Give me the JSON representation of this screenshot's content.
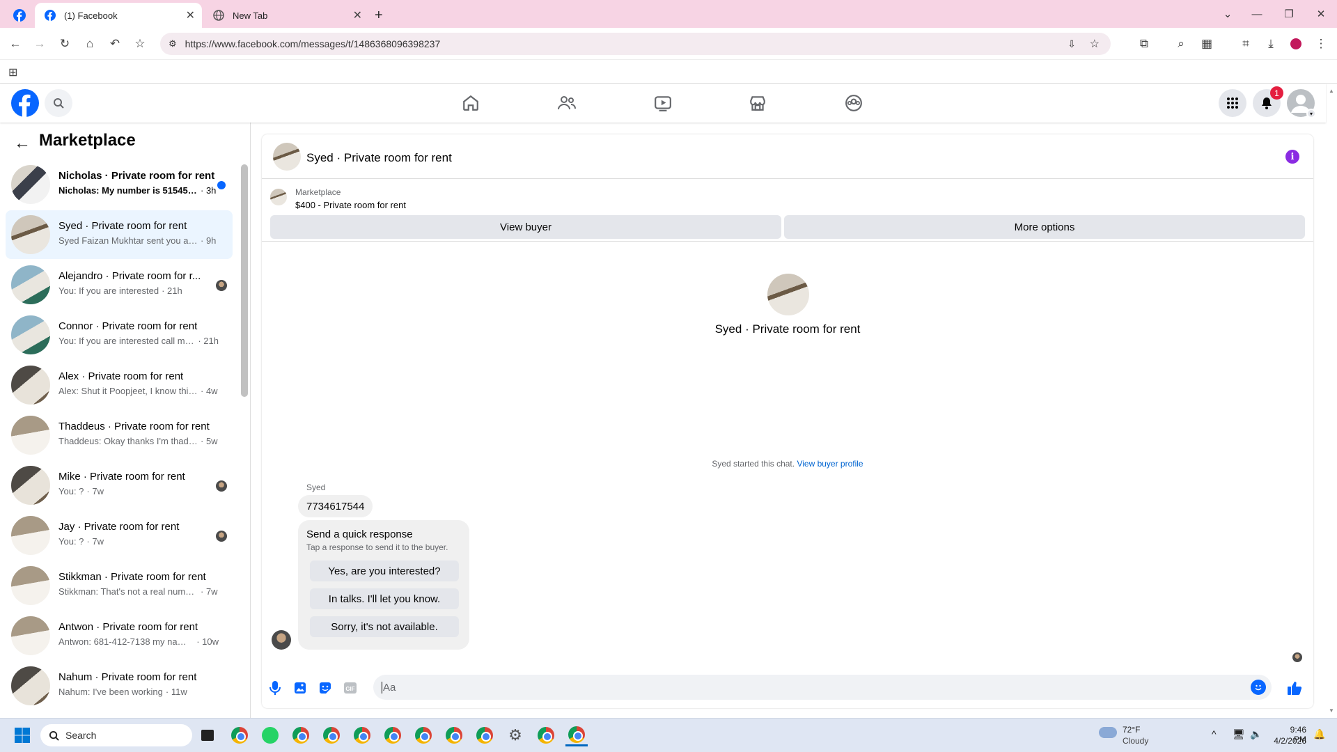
{
  "browser": {
    "tabs": [
      {
        "title": "(1) Facebook",
        "icon": "facebook-icon"
      },
      {
        "title": "New Tab",
        "icon": "globe-icon"
      }
    ],
    "url": "https://www.facebook.com/messages/t/1486368096398237",
    "new_tab_label": "+",
    "tab_close": "✕"
  },
  "fb": {
    "notifications_count": "1",
    "brand_color": "#0866ff"
  },
  "sidebar": {
    "title": "Marketplace",
    "conversations": [
      {
        "name": "Nicholas · Private room for rent",
        "preview": "Nicholas: My number is 515450...",
        "time": "· 3h",
        "unread": true
      },
      {
        "name": "Syed · Private room for rent",
        "preview": "Syed Faizan Mukhtar sent you a m...",
        "time": "· 9h",
        "selected": true
      },
      {
        "name": "Alejandro · Private room for r...",
        "preview": "You: If you are interested",
        "time": "· 21h"
      },
      {
        "name": "Connor · Private room for rent",
        "preview": "You: If you are interested call me ...",
        "time": "· 21h"
      },
      {
        "name": "Alex · Private room for rent",
        "preview": "Alex: Shut it Poopjeet, I know this i...",
        "time": "· 4w"
      },
      {
        "name": "Thaddeus · Private room for rent",
        "preview": "Thaddeus: Okay thanks I'm thadde...",
        "time": "· 5w"
      },
      {
        "name": "Mike · Private room for rent",
        "preview": "You: ?",
        "time": "· 7w"
      },
      {
        "name": "Jay · Private room for rent",
        "preview": "You: ?",
        "time": "· 7w"
      },
      {
        "name": "Stikkman · Private room for rent",
        "preview": "Stikkman: That's not a real number...",
        "time": "· 7w"
      },
      {
        "name": "Antwon · Private room for rent",
        "preview": "Antwon: 681-412-7138 my name ...",
        "time": "· 10w"
      },
      {
        "name": "Nahum · Private room for rent",
        "preview": "Nahum: I've been working",
        "time": "· 11w"
      }
    ]
  },
  "chat": {
    "header_title": "Syed · Private room for rent",
    "listing_source": "Marketplace",
    "listing_title": "$400 - Private room for rent",
    "view_buyer_label": "View buyer",
    "more_options_label": "More options",
    "center_name": "Syed · Private room for rent",
    "started_text": "Syed started this chat. ",
    "view_profile_link": "View buyer profile",
    "sender": "Syed",
    "message": "7734617544",
    "quick_title": "Send a quick response",
    "quick_subtitle": "Tap a response to send it to the buyer.",
    "quick_responses": [
      "Yes, are you interested?",
      "In talks. I'll let you know.",
      "Sorry, it's not available."
    ],
    "composer_placeholder": "Aa"
  },
  "taskbar": {
    "search_label": "Search",
    "weather_temp": "72°F",
    "weather_desc": "Cloudy",
    "time": "9:46 PM",
    "date": "4/2/2026"
  }
}
